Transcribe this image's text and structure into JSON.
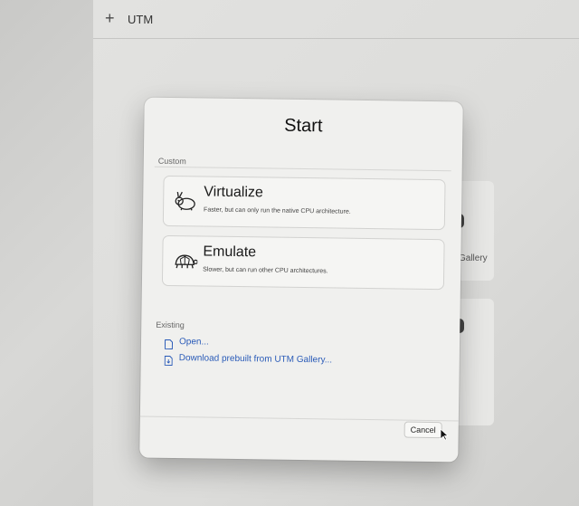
{
  "app": {
    "title": "UTM"
  },
  "background": {
    "add_icon": "plus-icon",
    "gallery_text": "Gallery"
  },
  "dialog": {
    "title": "Start",
    "custom_label": "Custom",
    "options": [
      {
        "title": "Virtualize",
        "description": "Faster, but can only run the native CPU architecture.",
        "icon": "rabbit-icon"
      },
      {
        "title": "Emulate",
        "description": "Slower, but can run other CPU architectures.",
        "icon": "turtle-icon"
      }
    ],
    "existing_label": "Existing",
    "links": [
      {
        "label": "Open...",
        "icon": "document-icon"
      },
      {
        "label": "Download prebuilt from UTM Gallery...",
        "icon": "download-document-icon"
      }
    ],
    "cancel_label": "Cancel"
  },
  "colors": {
    "link": "#2a5bb8",
    "dialog_bg": "#f0f0ee"
  }
}
